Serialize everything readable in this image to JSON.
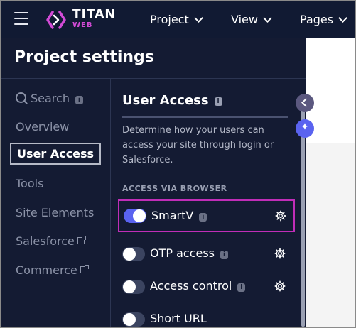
{
  "app": {
    "brand_name": "TITAN",
    "brand_sub": "WEB"
  },
  "topnav": {
    "items": [
      {
        "label": "Project"
      },
      {
        "label": "View"
      },
      {
        "label": "Pages"
      }
    ]
  },
  "panel": {
    "title": "Project settings"
  },
  "leftnav": {
    "search_label": "Search",
    "items": [
      {
        "label": "Overview"
      },
      {
        "label": "User Access"
      },
      {
        "label": "Tools"
      },
      {
        "label": "Site Elements"
      },
      {
        "label": "Salesforce"
      },
      {
        "label": "Commerce"
      }
    ]
  },
  "content": {
    "title": "User Access",
    "description": "Determine how your users can access your site through login or Salesforce.",
    "subheading": "ACCESS VIA BROWSER",
    "rows": [
      {
        "label": "SmartV",
        "enabled": true
      },
      {
        "label": "OTP access",
        "enabled": false
      },
      {
        "label": "Access control",
        "enabled": false
      },
      {
        "label": "Short URL",
        "enabled": false
      }
    ]
  },
  "badges": {
    "info_glyph": "i"
  },
  "colors": {
    "topbar_bg": "#111a33",
    "panel_bg": "#141b33",
    "accent": "#5a63f0",
    "brand_magenta": "#d24bd6",
    "highlight": "#c02db8"
  }
}
